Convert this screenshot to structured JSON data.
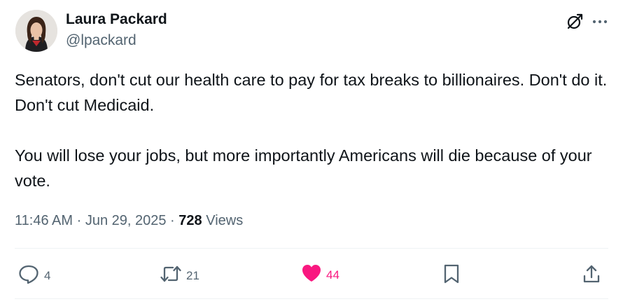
{
  "author": {
    "name": "Laura Packard",
    "handle": "@lpackard"
  },
  "tweet": {
    "paragraphs": [
      "Senators, don't cut our health care to pay for tax breaks to billionaires. Don't do it. Don't cut Medicaid.",
      "You will lose your jobs, but more importantly Americans will die because of your vote."
    ],
    "time": "11:46 AM",
    "separator": "·",
    "date": "Jun 29, 2025",
    "views_count": "728",
    "views_label": "Views"
  },
  "actions": {
    "replies": "4",
    "reposts": "21",
    "likes": "44",
    "liked": true
  },
  "icons": {
    "top": [
      "grok-icon",
      "more-icon"
    ],
    "actions": [
      "reply-icon",
      "repost-icon",
      "heart-icon",
      "bookmark-icon",
      "share-icon"
    ]
  },
  "colors": {
    "text": "#0f1419",
    "secondary": "#536471",
    "like": "#f91880",
    "divider": "#eff3f4"
  }
}
